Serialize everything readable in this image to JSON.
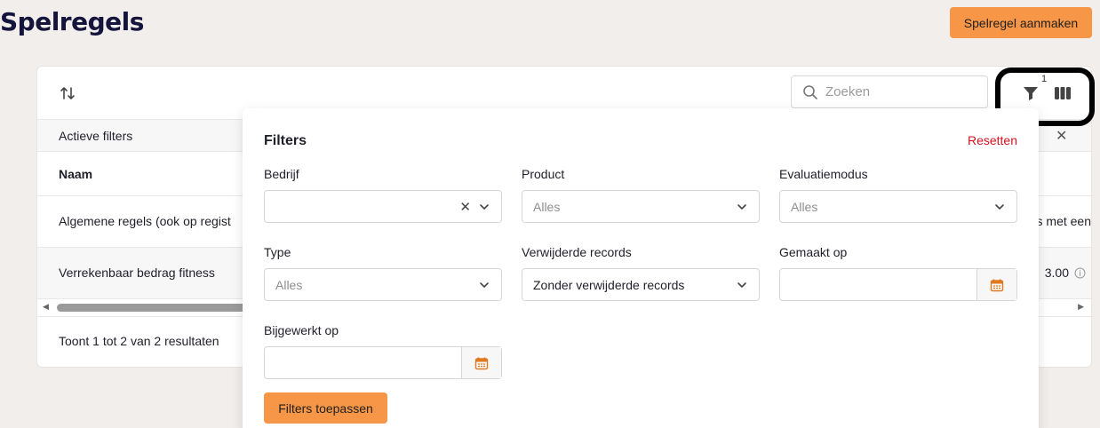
{
  "header": {
    "title": "Spelregels",
    "create_label": "Spelregel aanmaken"
  },
  "toolbar": {
    "search_placeholder": "Zoeken",
    "filter_count": "1"
  },
  "active_filters": {
    "label": "Actieve filters"
  },
  "table": {
    "column": "Naam",
    "rows": [
      {
        "name": "Algemene regels (ook op regist",
        "extra": "s met een"
      },
      {
        "name": "Verrekenbaar bedrag fitness",
        "extra": "3.00"
      }
    ],
    "result_text": "Toont 1 tot 2 van 2 resultaten"
  },
  "filters": {
    "title": "Filters",
    "reset_label": "Resetten",
    "company": {
      "label": "Bedrijf",
      "value": ""
    },
    "product": {
      "label": "Product",
      "value": "Alles"
    },
    "evaluation_mode": {
      "label": "Evaluatiemodus",
      "value": "Alles"
    },
    "type": {
      "label": "Type",
      "value": "Alles"
    },
    "deleted_records": {
      "label": "Verwijderde records",
      "value": "Zonder verwijderde records"
    },
    "created_on": {
      "label": "Gemaakt op",
      "value": ""
    },
    "updated_on": {
      "label": "Bijgewerkt op",
      "value": ""
    },
    "apply_label": "Filters toepassen"
  },
  "colors": {
    "accent": "#f79646",
    "reset": "#d2131f",
    "title": "#14143c"
  }
}
